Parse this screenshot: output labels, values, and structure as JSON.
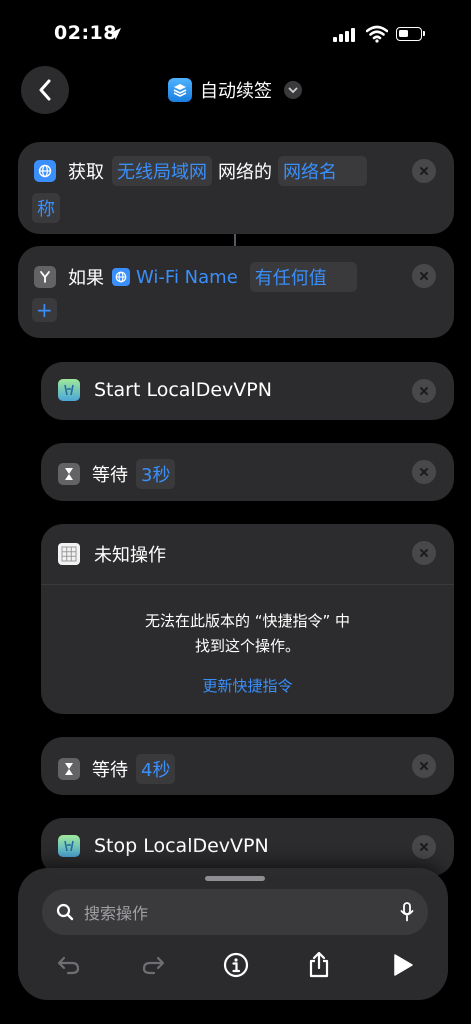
{
  "status": {
    "time": "02:18"
  },
  "nav": {
    "title": "自动续签"
  },
  "actions": {
    "get": {
      "verb": "获取",
      "network_type": "无线局域网",
      "connector": "网络的",
      "detail_line1": "网络名",
      "detail_line2": "称"
    },
    "if": {
      "verb": "如果",
      "var_name": "Wi-Fi Name",
      "condition": "有任何值",
      "add": "+"
    },
    "start_vpn": {
      "label": "Start LocalDevVPN"
    },
    "wait1": {
      "verb": "等待",
      "duration": "3秒"
    },
    "unknown": {
      "title": "未知操作",
      "message_line1": "无法在此版本的 “快捷指令” 中",
      "message_line2": "找到这个操作。",
      "link": "更新快捷指令"
    },
    "wait2": {
      "verb": "等待",
      "duration": "4秒"
    },
    "stop_vpn": {
      "label": "Stop LocalDevVPN"
    }
  },
  "bottom": {
    "search_placeholder": "搜索操作"
  }
}
